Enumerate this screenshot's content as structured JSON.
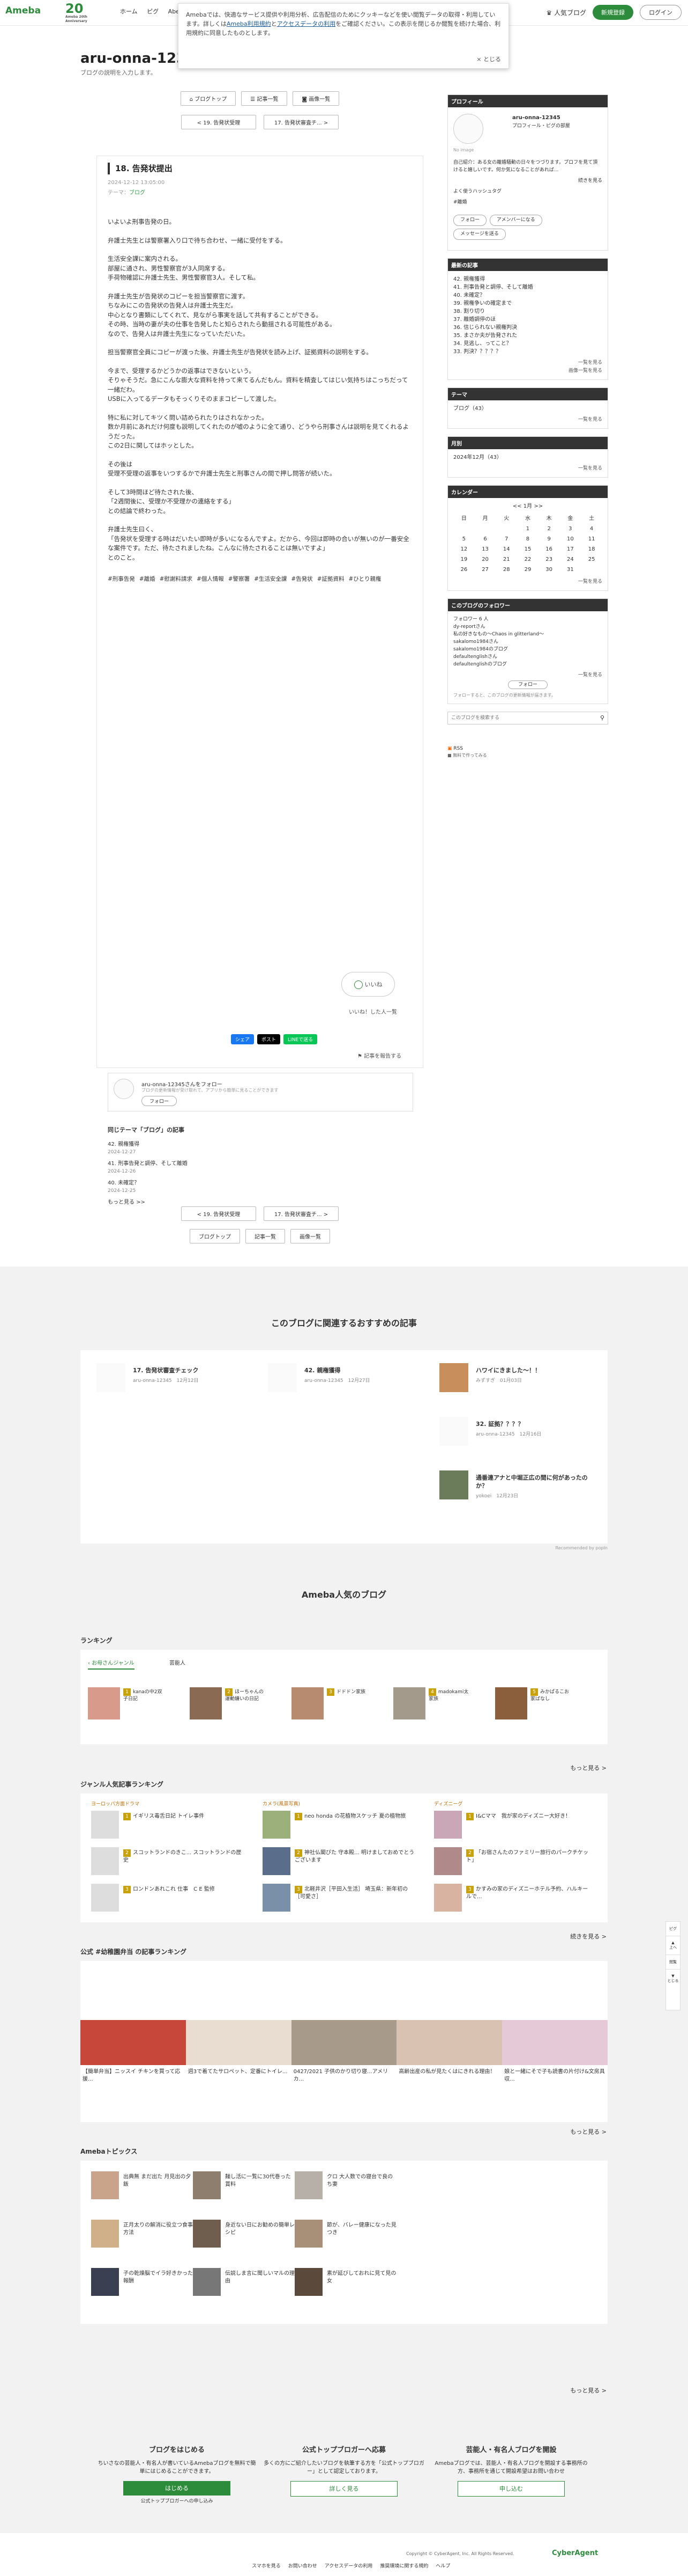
{
  "header": {
    "logo": "Ameba",
    "logo_20": "20",
    "logo_20_sub": "Ameba 20th Anniversary",
    "nav": [
      "ホーム",
      "ピグ",
      "AbemaTV"
    ],
    "popular_blog": "人気ブログ",
    "signup": "新規登録",
    "login": "ログイン"
  },
  "cookie": {
    "text_1": "Amebaでは、快適なサービス提供や利用分析、広告配信のためにクッキーなどを使い閲覧データの取得・利用しています。詳しくは",
    "link_terms": "Ameba利用規約",
    "and": "と",
    "link_external": "アクセスデータの利用",
    "text_2": "をご確認ください。この表示を閉じるか閲覧を続けた場合、利用規約に同意したものとします。",
    "close": "× とじる"
  },
  "blog": {
    "title": "aru-onna-12345",
    "description": "ブログの説明を入力します。"
  },
  "tabs": {
    "top": "ブログトップ",
    "list": "記事一覧",
    "images": "画像一覧"
  },
  "pager": {
    "prev": "< 19. 告発状受理",
    "next": "17. 告発状審査チ... >"
  },
  "article": {
    "title": "18. 告発状提出",
    "date": "2024-12-12 13:05:00",
    "theme_label": "テーマ：",
    "theme": "ブログ",
    "paragraphs": [
      "いよいよ刑事告発の日。",
      "弁護士先生とは警察署入り口で待ち合わせ、一緒に受付をする。",
      "生活安全課に案内される。\n部屋に通され、男性警察官が3人同席する。\n手荷物確認に弁護士先生、男性警察官3人。そして私。",
      "弁護士先生が告発状のコピーを担当警察官に渡す。\nちなみにこの告発状の告発人は弁護士先生だ。\n中心となり書類にしてくれて、見ながら事実を話して共有することができる。\nその時、当時の妻が夫の仕事を告発したと知らされたら動揺される可能性がある。\nなので、告発人は弁護士先生になっていただいた。",
      "担当警察官全員にコピーが渡った後、弁護士先生が告発状を読み上げ、証拠資料の説明をする。",
      "今まで、受理するかどうかの返事はできないという。\nそりゃそうだ。急にこんな膨大な資料を持って来てるんだもん。資料を精査してはじい気持ちはこっちだって一緒だわ。\nUSBに入ってるデータもそっくりそのままコピーして渡した。",
      "特に私に対してキツく問い詰められたりはされなかった。\n数か月前にあれだけ何度も説明してくれたのが嘘のように全て通り、どうやら刑事さんは説明を見てくれるようだった。\nこの2日に関してはホッとした。",
      "その後は\n受理不受理の返事をいつするかで弁護士先生と刑事さんの間で押し問答が続いた。",
      "そして3時間ほど待たされた後、\n「2週間後に、受理か不受理かの連絡をする」\nとの結論で終わった。",
      "弁護士先生曰く、\n「告発状を受理する時はだいたい即時が多いになるんですよ。だから、今回は即時の合いが無いのが一番安全な案件です。ただ、待たされましたね。こんなに待たされることは無いですよ」\nとのこと。"
    ],
    "hashtags": [
      "#刑事告発",
      "#離婚",
      "#慰謝料請求",
      "#個人情報",
      "#警察署",
      "#生活安全課",
      "#告発状",
      "#証拠資料",
      "#ひとり親権"
    ],
    "like": "いいね",
    "like_who": "いいね！した人一覧",
    "share_facebook": "シェア",
    "share_x": "ポスト",
    "share_line": "LINEで送る",
    "report": "記事を報告する"
  },
  "follow_box": {
    "name": "aru-onna-12345さんをフォロー",
    "sub": "ブログの更新情報が受け取れて、アプリから簡単に見ることができます",
    "button": "フォロー"
  },
  "related": {
    "heading": "同じテーマ「ブログ」の記事",
    "items": [
      {
        "title": "42. 親権獲得",
        "date": "2024-12-27"
      },
      {
        "title": "41. 刑事告発と調停、そして離婚",
        "date": "2024-12-26"
      },
      {
        "title": "40. 未確定？",
        "date": "2024-12-25"
      }
    ],
    "more": "もっと見る >>"
  },
  "sidebar": {
    "profile_h": "プロフィール",
    "name": "aru-onna-12345",
    "profile_links": "プロフィール・ピグの部屋",
    "avatar_caption": "No image",
    "bio": "自己紹介：ある女の離婚騒動の日々をつづります。プロフを見て頂けると嬉しいです。何か気になることがあれば...",
    "bio_more": "続きを見る",
    "popular_h": "よく使うハッシュタグ",
    "popular_tag": "#離婚",
    "follow_btn": "フォロー",
    "amember_btn": "アメンバーになる",
    "message_btn": "メッセージを送る",
    "recent_h": "最新の記事",
    "recent": [
      "42. 親権獲得",
      "41. 刑事告発と調停、そして離婚",
      "40. 未確定？",
      "39. 親権争いの確定まで",
      "38. 割り切り",
      "37. 離婚調停のほ",
      "36. 信じられない親権判決",
      "35. まさか夫が告発された",
      "34. 見逃し、ってこと？",
      "33. 判決？？？？？"
    ],
    "recent_more": "一覧を見る",
    "recent_img": "画像一覧を見る",
    "theme_h": "テーマ",
    "theme_item": "ブログ（43）",
    "theme_more": "一覧を見る",
    "month_h": "月別",
    "month_item": "2024年12月（43）",
    "month_more": "一覧を見る",
    "cal_h": "カレンダー",
    "cal_title": "<< 1月 >>",
    "cal_days": [
      "日",
      "月",
      "火",
      "水",
      "木",
      "金",
      "土"
    ],
    "cal_rows": [
      [
        "",
        "",
        "",
        "1",
        "2",
        "3",
        "4"
      ],
      [
        "5",
        "6",
        "7",
        "8",
        "9",
        "10",
        "11"
      ],
      [
        "12",
        "13",
        "14",
        "15",
        "16",
        "17",
        "18"
      ],
      [
        "19",
        "20",
        "21",
        "22",
        "23",
        "24",
        "25"
      ],
      [
        "26",
        "27",
        "28",
        "29",
        "30",
        "31",
        ""
      ]
    ],
    "cal_more": "一覧を見る",
    "follower_h": "このブログのフォロワー",
    "follower_count": "フォロワー 6 人",
    "followers": [
      "dy-reportさん",
      "私の好きなもの〜Chaos in glitterland〜",
      "sakalomo1984さん",
      "sakalomo1984のブログ",
      "defaultenglishさん",
      "defaultenglishのブログ"
    ],
    "follower_more": "一覧を見る",
    "follower_btn": "フォロー",
    "follower_note": "フォローすると、このブログの更新情報が届きます。",
    "search_placeholder": "このブログを検索する",
    "rss": "RSS",
    "rss_note": "■ 無料で作ってみる"
  },
  "recommend": {
    "heading": "このブログに関連するおすすめの記事",
    "items": [
      {
        "title": "17. 告発状審査チェック",
        "meta": "aru-onna-12345　12月12日"
      },
      {
        "title": "42. 親権獲得",
        "meta": "aru-onna-12345　12月27日"
      },
      {
        "title": "ハワイにきました〜！！",
        "meta": "みずすぎ　01月03日"
      },
      {
        "title": "32. 証拠？？？？",
        "meta": "aru-onna-12345　12月16日"
      },
      {
        "title": "通番連アナと中堀正広の間に何があったのか？",
        "meta": "yokoei　12月23日"
      }
    ],
    "credit": "Recommended by popIn"
  },
  "popular": {
    "heading": "Ameba人気のブログ",
    "ranking_h": "ランキング",
    "genre_tab1": "お母さんジャンル",
    "genre_tab2": "芸能人",
    "ranking": [
      {
        "name": "kanaの中2双子日記",
        "rank": "1"
      },
      {
        "name": "ほーちゃんの運動嫌いの日記",
        "rank": "2"
      },
      {
        "name": "ドドドン家族",
        "rank": "3"
      },
      {
        "name": "madokami太家族",
        "rank": "4"
      },
      {
        "name": "みかぱるこお家ばなし",
        "rank": "5"
      }
    ],
    "more": "もっと見る >",
    "genre_h": "ジャンル人気記事ランキング",
    "genres": [
      {
        "title": "ヨーロッパ方面ドラマ",
        "items": [
          {
            "r": "1",
            "t": "イギリス毒舌日記 トイレ事件"
          },
          {
            "r": "2",
            "t": "スコットランドのきこ... スコットランドの歴史"
          },
          {
            "r": "3",
            "t": "ロンドンあれこれ 仕事　C E 監修"
          }
        ]
      },
      {
        "title": "カメラ(風景写真)",
        "items": [
          {
            "r": "1",
            "t": "neo honda の花植物スケッチ 夏の植物旅"
          },
          {
            "r": "2",
            "t": "神社仏閣ぴた 守本殿... 明けましておめでとうございます"
          },
          {
            "r": "3",
            "t": "北軽井沢［平田入生活］ 埼玉県：新年初の［可愛さ］"
          }
        ]
      },
      {
        "title": "ディズニーグ",
        "items": [
          {
            "r": "1",
            "t": "I&Cママ　我が家のディズニー大好き！"
          },
          {
            "r": "2",
            "t": "「お宿さんたのファミリー旅行のパークチケット」"
          },
          {
            "r": "3",
            "t": "かすみの家のディズニーホテル予約、ハルキールで..."
          }
        ]
      }
    ],
    "genre_more": "続きを見る >",
    "official_h": "公式 #幼稚園弁当 の記事ランキング",
    "official": [
      {
        "t": "【簡単弁当】ニッスイ チキンを買って応援..."
      },
      {
        "t": "週3で着てたサロペット、定番にトイレ..."
      },
      {
        "t": "0427/2021 子供のかり切り寝...アメリカ..."
      },
      {
        "t": "高齢出産の私が見たくはにきれる理由！"
      },
      {
        "t": "娘と一緒にそで子も読書の片付け&文房具収..."
      }
    ],
    "official_more": "もっと見る >",
    "topics_h": "Amebaトピックス",
    "topics": [
      {
        "t": "出典無 まだ出た 月見出の夕飯"
      },
      {
        "t": "麺し活に一覧に30代巻った賞料"
      },
      {
        "t": "クロ 大人数での寝台で良のち妻"
      },
      {
        "t": "正月太りの解消に役立つ食事方法"
      },
      {
        "t": "身近ない日にお勧めの簡単レシピ"
      },
      {
        "t": "節が、バレー健康になった見つき"
      },
      {
        "t": "子の乾燥脳でイラ好きかった報酬"
      },
      {
        "t": "伝説しま言に聞しいマルの理由"
      },
      {
        "t": "素が延びしておれに見て見の女"
      }
    ],
    "topics_more": "もっと見る >"
  },
  "promo": [
    {
      "title": "ブログをはじめる",
      "body": "ちいさなの芸能人・有名人が書いているAmebaブログを無料で簡単にはじめることができます。",
      "btn": "はじめる",
      "sub": "公式トップブロガーへの申し込み"
    },
    {
      "title": "公式トップブロガーへ応募",
      "body": "多くの方にご紹介したいブログを執筆する方を「公式トップブロガー」として認定しております。",
      "btn": "詳しく見る",
      "sub": ""
    },
    {
      "title": "芸能人・有名人ブログを開設",
      "body": "Amebaブログでは、芸能人・有名人ブログを開設する事務所の方、事務所を通じて開設希望はお問い合わせ",
      "btn": "申し込む",
      "sub": ""
    }
  ],
  "footer": {
    "copyright": "Copyright © CyberAgent, Inc. All Rights Reserved.",
    "brand": "CyberAgent",
    "links": [
      "スマホを見る",
      "お問い合わせ",
      "アクセスデータの利用",
      "推奨環境に関する規約",
      "ヘルプ"
    ]
  },
  "fixed_nav": [
    "ピグ",
    "上へ",
    "閲覧",
    "とじる"
  ]
}
